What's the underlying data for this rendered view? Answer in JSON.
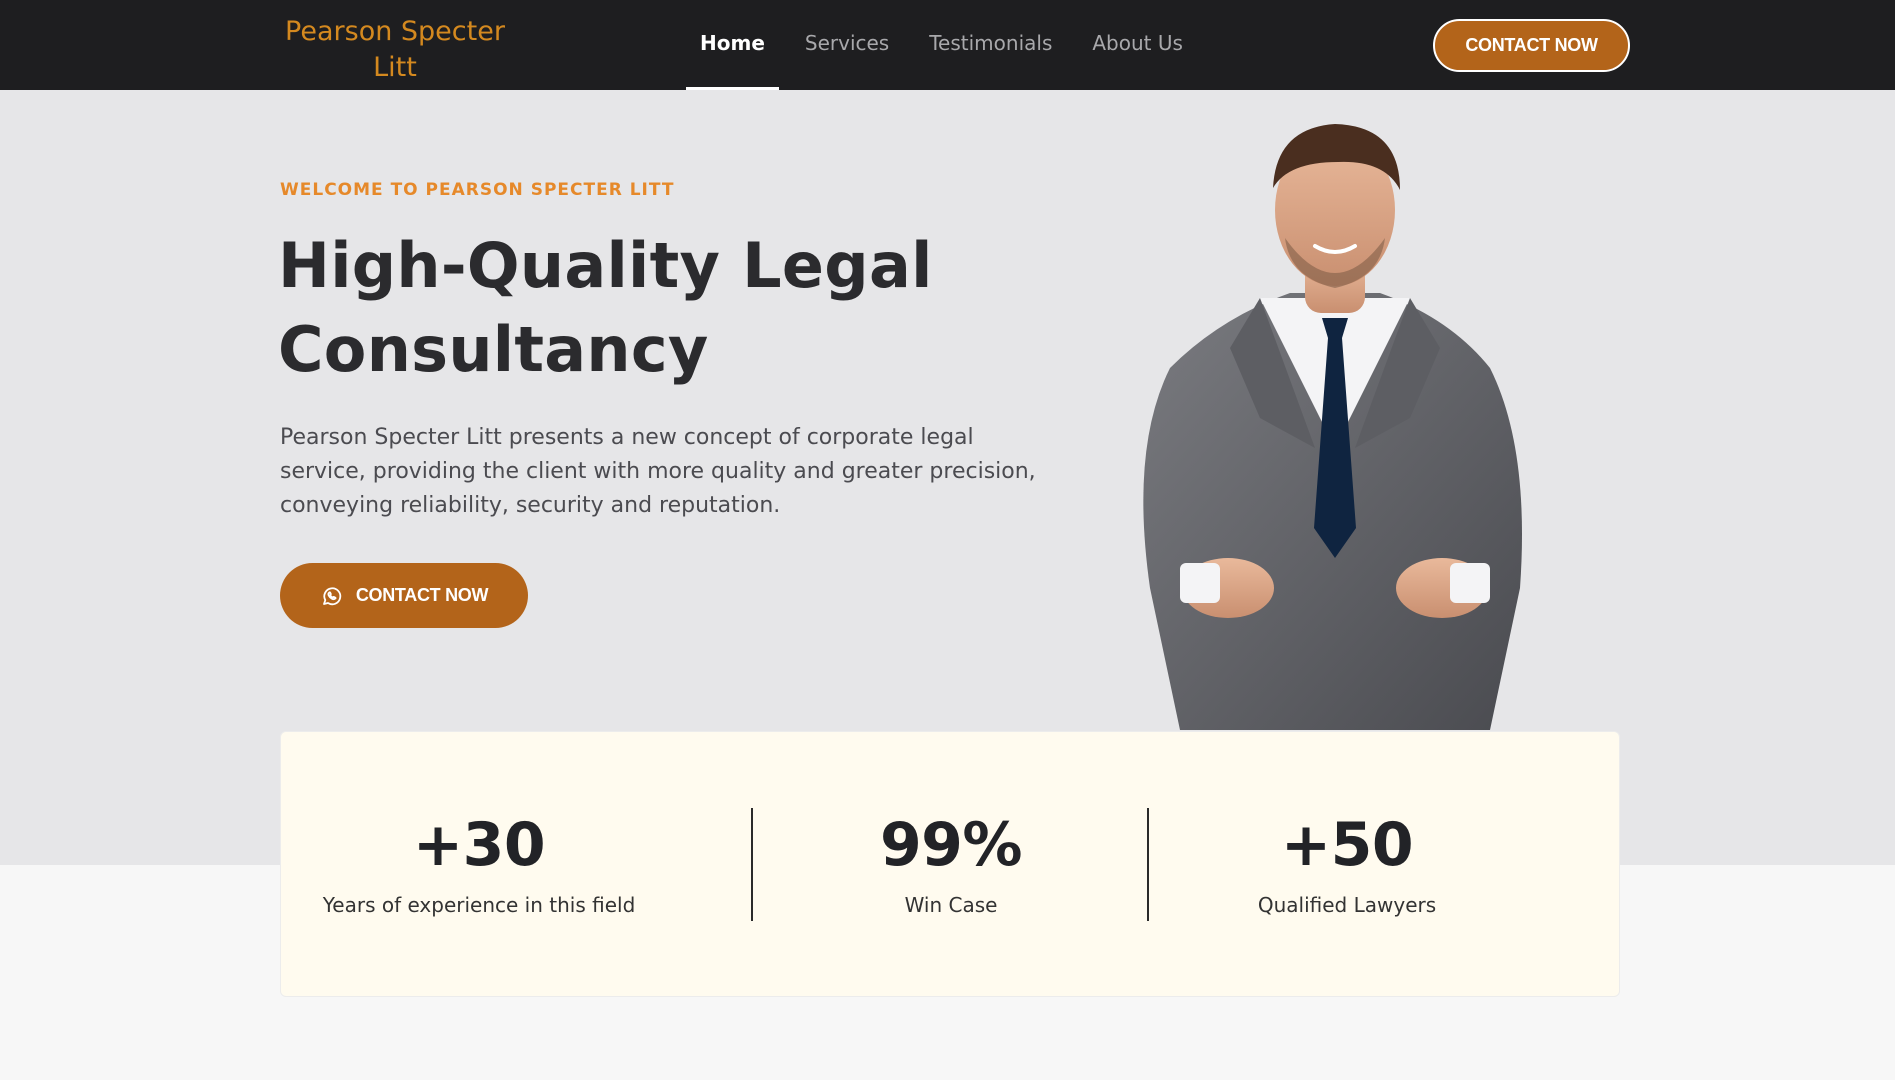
{
  "brand": {
    "name": "Pearson Specter Litt",
    "color": "#d4891f"
  },
  "nav": {
    "items": [
      {
        "label": "Home",
        "active": true
      },
      {
        "label": "Services",
        "active": false
      },
      {
        "label": "Testimonials",
        "active": false
      },
      {
        "label": "About Us",
        "active": false
      }
    ],
    "cta_label": "CONTACT NOW"
  },
  "hero": {
    "eyebrow": "WELCOME TO PEARSON SPECTER LITT",
    "headline": "High-Quality Legal Consultancy",
    "lead": "Pearson Specter Litt presents a new concept of corporate legal service, providing the client with more quality and greater precision, conveying reliability, security and reputation.",
    "cta_label": "CONTACT NOW",
    "cta_icon": "whatsapp-icon",
    "image": "man-in-grey-suit-portrait"
  },
  "stats": [
    {
      "value": "+30",
      "label": "Years of experience in this field"
    },
    {
      "value": "99%",
      "label": "Win Case"
    },
    {
      "value": "+50",
      "label": "Qualified Lawyers"
    }
  ],
  "colors": {
    "accent": "#b3641a",
    "eyebrow": "#e6892a",
    "navbar": "#1e1e20",
    "hero_bg": "#e6e6e8",
    "stats_bg": "#fffbef"
  }
}
